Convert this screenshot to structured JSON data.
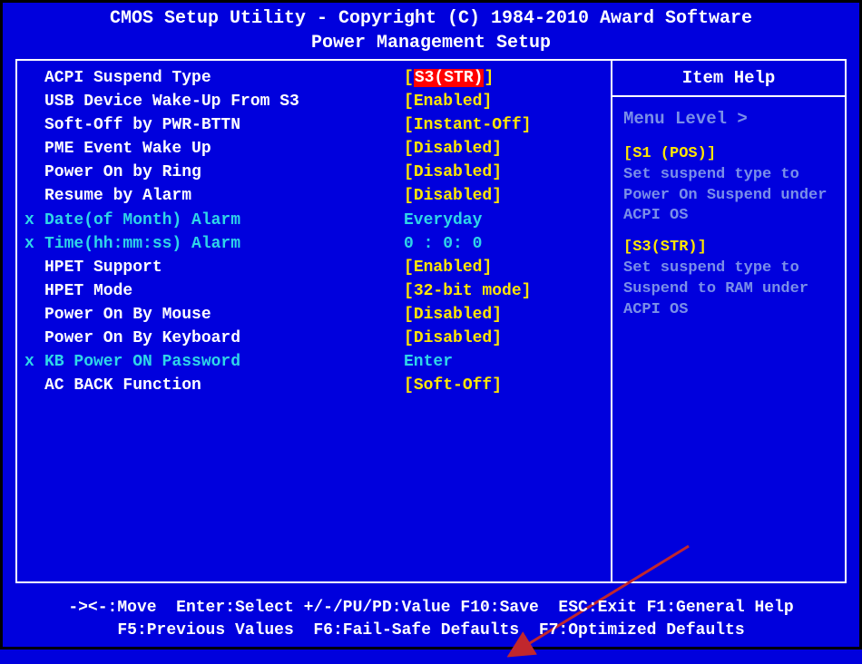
{
  "header": {
    "line1": "CMOS Setup Utility - Copyright (C) 1984-2010 Award Software",
    "line2": "Power Management Setup"
  },
  "items": [
    {
      "mark": "",
      "label": "ACPI Suspend Type",
      "br_open": "[",
      "val": "S3(STR)",
      "br_close": "]",
      "selected": true,
      "sub": false
    },
    {
      "mark": "",
      "label": "USB Device Wake-Up From S3",
      "br_open": "[",
      "val": "Enabled",
      "br_close": "]",
      "selected": false,
      "sub": false
    },
    {
      "mark": "",
      "label": "Soft-Off by PWR-BTTN",
      "br_open": "[",
      "val": "Instant-Off",
      "br_close": "]",
      "selected": false,
      "sub": false
    },
    {
      "mark": "",
      "label": "PME Event Wake Up",
      "br_open": "[",
      "val": "Disabled",
      "br_close": "]",
      "selected": false,
      "sub": false
    },
    {
      "mark": "",
      "label": "Power On by Ring",
      "br_open": "[",
      "val": "Disabled",
      "br_close": "]",
      "selected": false,
      "sub": false
    },
    {
      "mark": "",
      "label": "Resume by Alarm",
      "br_open": "[",
      "val": "Disabled",
      "br_close": "]",
      "selected": false,
      "sub": false
    },
    {
      "mark": "x",
      "label": "Date(of Month) Alarm",
      "br_open": "",
      "val": " Everyday",
      "br_close": "",
      "selected": false,
      "sub": true
    },
    {
      "mark": "x",
      "label": "Time(hh:mm:ss) Alarm",
      "br_open": "",
      "val": "  0 :   0:   0",
      "br_close": "",
      "selected": false,
      "sub": true
    },
    {
      "mark": "",
      "label": "HPET Support",
      "br_open": "[",
      "val": "Enabled",
      "br_close": "]",
      "selected": false,
      "sub": false
    },
    {
      "mark": "",
      "label": "HPET Mode",
      "br_open": "[",
      "val": "32-bit mode",
      "br_close": "]",
      "selected": false,
      "sub": false
    },
    {
      "mark": "",
      "label": "Power On By Mouse",
      "br_open": "[",
      "val": "Disabled",
      "br_close": "]",
      "selected": false,
      "sub": false
    },
    {
      "mark": "",
      "label": "Power On By Keyboard",
      "br_open": "[",
      "val": "Disabled",
      "br_close": "]",
      "selected": false,
      "sub": false
    },
    {
      "mark": "x",
      "label": "KB Power ON Password",
      "br_open": "",
      "val": " Enter",
      "br_close": "",
      "selected": false,
      "sub": true
    },
    {
      "mark": "",
      "label": "AC BACK Function",
      "br_open": "[",
      "val": "Soft-Off",
      "br_close": "]",
      "selected": false,
      "sub": false
    }
  ],
  "help": {
    "title": "Item Help",
    "menu_level": "Menu Level  >",
    "option1_head": "[S1 (POS)]",
    "option1_text": "Set suspend type to Power On Suspend under ACPI OS",
    "option2_head": "[S3(STR)]",
    "option2_text": "Set suspend type to Suspend to RAM under ACPI OS"
  },
  "footer": {
    "line1": "-><-:Move  Enter:Select +/-/PU/PD:Value F10:Save  ESC:Exit F1:General Help",
    "line2": "F5:Previous Values  F6:Fail-Safe Defaults  F7:Optimized Defaults"
  }
}
